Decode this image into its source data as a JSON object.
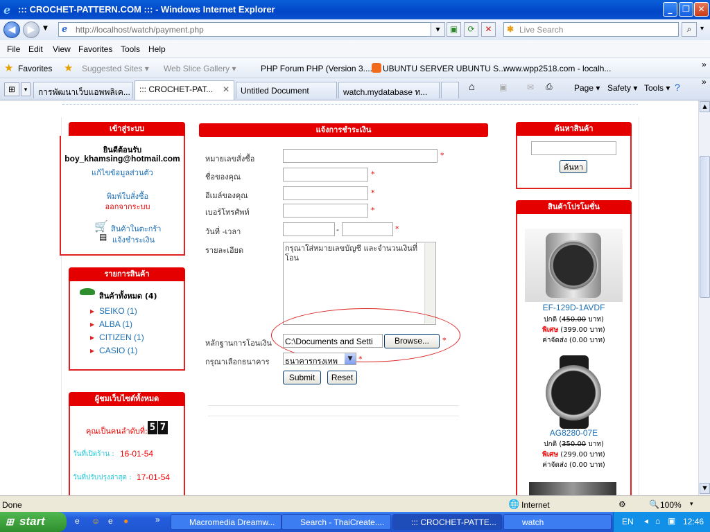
{
  "window": {
    "title": "::: CROCHET-PATTERN.COM ::: - Windows Internet Explorer"
  },
  "address": {
    "url_prefix": "http://localhost",
    "url_path": "/watch/payment.php",
    "live_search_placeholder": "Live Search"
  },
  "menu": [
    "File",
    "Edit",
    "View",
    "Favorites",
    "Tools",
    "Help"
  ],
  "favorites_bar": {
    "label": "Favorites",
    "items": [
      "Suggested Sites ▾",
      "Web Slice Gallery ▾",
      "PHP  Forum PHP (Version 3....",
      "UBUNTU SERVER UBUNTU S...",
      "www.wpp2518.com - localh..."
    ]
  },
  "tabs": [
    "การพัฒนาเว็บแอพพลิเค...",
    "::: CROCHET-PAT...",
    "Untitled Document",
    "watch.mydatabase ท..."
  ],
  "command_bar": [
    "Page ▾",
    "Safety ▾",
    "Tools ▾"
  ],
  "login_box": {
    "title": "เข้าสู่ระบบ",
    "welcome": "ยินดีต้อนรับ",
    "email": "boy_khamsing@hotmail.com",
    "edit_profile": "แก้ไขข้อมูลส่วนตัว",
    "print_order": "พิมพ์ใบสั่งซื้อ",
    "logout": "ออกจากระบบ",
    "cart": "สินค้าในตะกร้า",
    "notify_payment": "แจ้งชำระเงิน"
  },
  "products_box": {
    "title": "รายการสินค้า",
    "all_label": "สินค้าทั้งหมด (4)",
    "categories": [
      "SEIKO (1)",
      "ALBA (1)",
      "CITIZEN (1)",
      "CASIO (1)"
    ]
  },
  "visitors_box": {
    "title": "ผู้ชมเว็บไซต์ทั้งหมด",
    "rank_label": "คุณเป็นคนลำดับที่:",
    "counter": [
      "5",
      "7"
    ],
    "open_label": "วันที่เปิดร้าน :",
    "open_date": "16-01-54",
    "update_label": "วันที่ปรับปรุงล่าสุด :",
    "update_date": "17-01-54"
  },
  "payment_form": {
    "title": "แจ้งการชำระเงิน",
    "fields": {
      "order_no": "หมายเลขสั่งซื้อ",
      "name": "ชื่อของคุณ",
      "email": "อีเมล์ของคุณ",
      "phone": "เบอร์โทรศัพท์",
      "datetime": "วันที่ -เวลา",
      "detail": "รายละเอียด",
      "evidence": "หลักฐานการโอนเงิน",
      "bank": "กรุณาเลือกธนาคาร"
    },
    "detail_value": "กรุณาใส่หมายเลขบัญชี และจำนวนเงินที่โอน",
    "file_value": "C:\\Documents and Setti",
    "browse_label": "Browse...",
    "bank_value": "ธนาคารกรุงเทพ",
    "datetime_sep": "-",
    "required_mark": "*",
    "submit_label": "Submit",
    "reset_label": "Reset"
  },
  "search_box": {
    "title": "ค้นหาสินค้า",
    "button": "ค้นหา"
  },
  "promo_box": {
    "title": "สินค้าโปรโมชั่น",
    "items": [
      {
        "model": "EF-129D-1AVDF",
        "normal_label": "ปกติ",
        "normal_price": "450.00",
        "unit": "บาท",
        "special_label": "พิเศษ",
        "special_price": "(399.00 บาท)",
        "shipping": "ค่าจัดส่ง (0.00 บาท)"
      },
      {
        "model": "AG8280-07E",
        "normal_label": "ปกติ",
        "normal_price": "350.00",
        "unit": "บาท",
        "special_label": "พิเศษ",
        "special_price": "(299.00 บาท)",
        "shipping": "ค่าจัดส่ง (0.00 บาท)"
      }
    ]
  },
  "status": {
    "left": "Done",
    "zone": "Internet",
    "zoom": "100%"
  },
  "taskbar": {
    "start": "start",
    "tasks": [
      "Macromedia Dreamw...",
      "Search - ThaiCreate....",
      "::: CROCHET-PATTE...",
      "watch"
    ],
    "lang": "EN",
    "clock": "12:46"
  },
  "colors": {
    "accent_red": "#e50000",
    "link_blue": "#1b6fb6",
    "xp_blue": "#245edc"
  }
}
